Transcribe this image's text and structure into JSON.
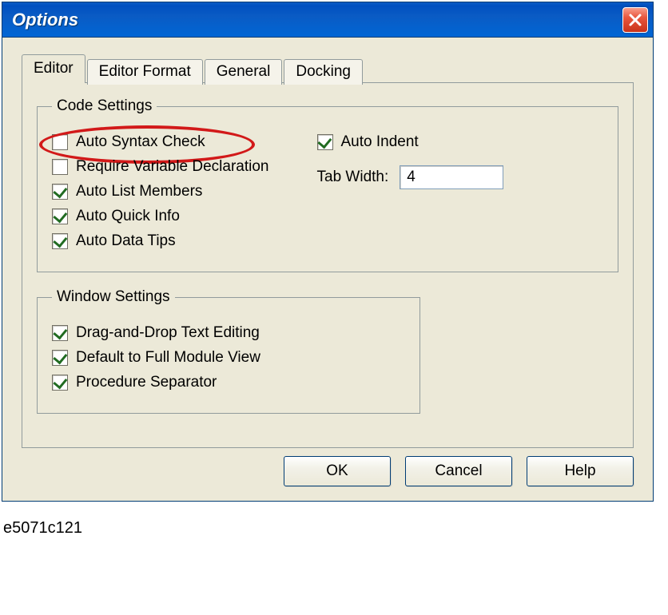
{
  "window_title": "Options",
  "tabs": {
    "t0": "Editor",
    "t1": "Editor Format",
    "t2": "General",
    "t3": "Docking",
    "active_index": 0
  },
  "code_settings": {
    "legend": "Code Settings",
    "left": {
      "auto_syntax_check": {
        "label": "Auto Syntax Check",
        "checked": false,
        "highlighted": true
      },
      "require_var_decl": {
        "label": "Require Variable Declaration",
        "checked": false
      },
      "auto_list_members": {
        "label": "Auto List Members",
        "checked": true
      },
      "auto_quick_info": {
        "label": "Auto Quick Info",
        "checked": true
      },
      "auto_data_tips": {
        "label": "Auto Data Tips",
        "checked": true
      }
    },
    "right": {
      "auto_indent": {
        "label": "Auto Indent",
        "checked": true
      },
      "tab_width_label": "Tab Width:",
      "tab_width_value": "4"
    }
  },
  "window_settings": {
    "legend": "Window Settings",
    "drag_drop": {
      "label": "Drag-and-Drop Text Editing",
      "checked": true
    },
    "full_module": {
      "label": "Default to Full Module View",
      "checked": true
    },
    "proc_sep": {
      "label": "Procedure Separator",
      "checked": true
    }
  },
  "buttons": {
    "ok": "OK",
    "cancel": "Cancel",
    "help": "Help"
  },
  "footnote": "e5071c121"
}
